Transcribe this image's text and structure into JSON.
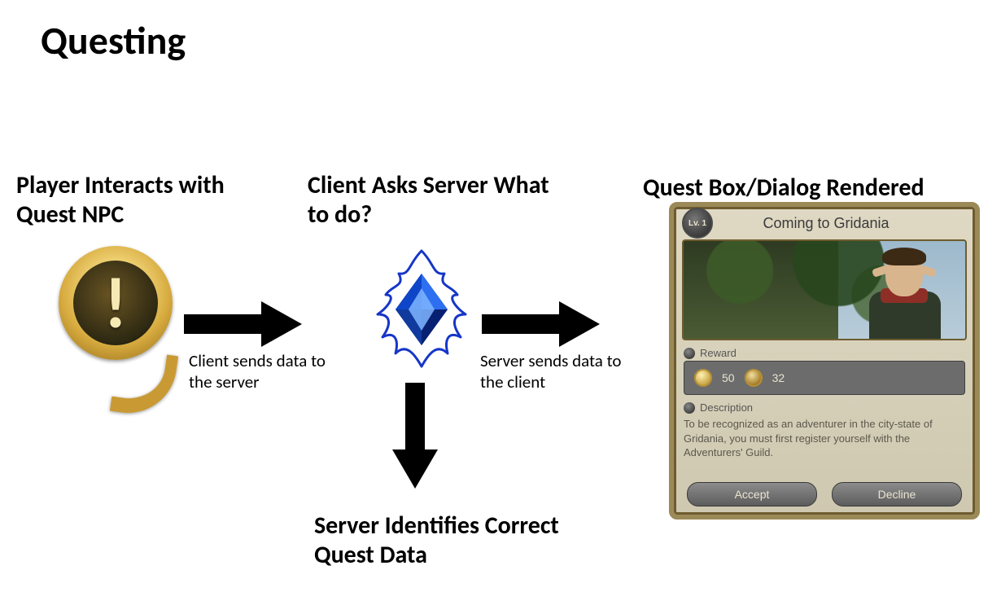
{
  "title": "Questing",
  "headers": {
    "left": "Player Interacts with Quest NPC",
    "middle": "Client Asks Server What to do?",
    "right": "Quest Box/Dialog Rendered",
    "bottom": "Server Identifies Correct Quest Data"
  },
  "captions": {
    "client_to_server": "Client sends data to the server",
    "server_to_client": "Server sends data to the client"
  },
  "icons": {
    "quest_marker": "quest-exclamation-icon",
    "crystal": "crystal-flame-icon"
  },
  "quest_dialog": {
    "level_badge": "Lv. 1",
    "title": "Coming to Gridania",
    "reward_label": "Reward",
    "rewards": {
      "value1": "50",
      "value2": "32"
    },
    "description_label": "Description",
    "description": "To be recognized as an adventurer in the city-state of Gridania, you must first register yourself with the Adventurers' Guild.",
    "buttons": {
      "accept": "Accept",
      "decline": "Decline"
    }
  }
}
